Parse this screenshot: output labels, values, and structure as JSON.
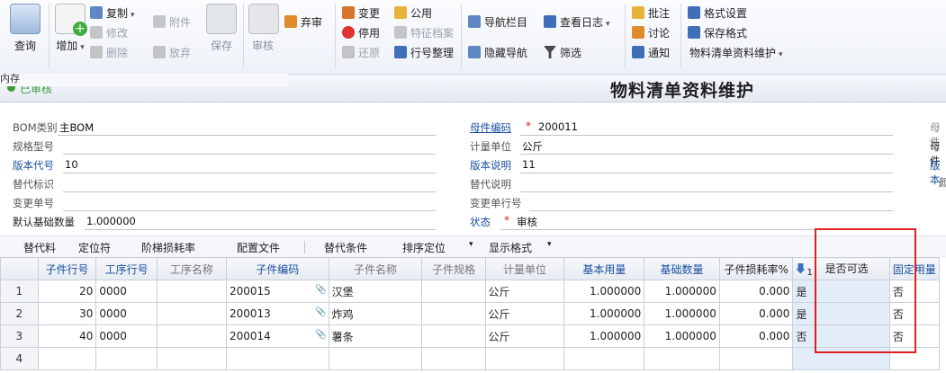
{
  "ribbon": {
    "query": "查询",
    "add": "增加",
    "copy": "复制",
    "modify": "修改",
    "delete": "删除",
    "attach": "附件",
    "abandon": "放弃",
    "save": "保存",
    "audit": "审核",
    "unaudit": "弃审",
    "change": "变更",
    "disable": "停用",
    "restore": "还原",
    "public": "公用",
    "feature_file": "特征档案",
    "row_arrange": "行号整理",
    "nav_bar": "导航栏目",
    "hide_nav": "隐藏导航",
    "view_log": "查看日志",
    "filter": "筛选",
    "annotate": "批注",
    "discuss": "讨论",
    "notify": "通知",
    "format_settings": "格式设置",
    "save_format": "保存格式",
    "format_select": "物料清单资料维护"
  },
  "overlay_text": "内存",
  "status": "已审核",
  "title": "物料清单资料维护",
  "form": {
    "bom_type_label": "BOM类别",
    "bom_type": "主BOM",
    "spec_label": "规格型号",
    "spec": "",
    "version_label": "版本代号",
    "version": "10",
    "alt_label": "替代标识",
    "alt": "",
    "change_no_label": "变更单号",
    "change_no": "",
    "default_qty_label": "默认基础数量",
    "default_qty": "1.000000",
    "parent_code_label": "母件编码",
    "parent_code": "200011",
    "unit_label": "计量单位",
    "unit": "公斤",
    "version_desc_label": "版本说明",
    "version_desc": "11",
    "alt_desc_label": "替代说明",
    "alt_desc": "",
    "change_row_label": "变更单行号",
    "change_row": "",
    "state_label": "状态",
    "state": "审核",
    "right_col": [
      "母件",
      "母件",
      "版本",
      "颜"
    ]
  },
  "grid_toolbar": [
    "替代料",
    "定位符",
    "阶梯损耗率",
    "配置文件",
    "替代条件",
    "排序定位",
    "显示格式"
  ],
  "columns": [
    "子件行号",
    "工序行号",
    "工序名称",
    "子件编码",
    "子件名称",
    "子件规格",
    "计量单位",
    "基本用量",
    "基础数量",
    "子件损耗率%",
    "是否可选",
    "固定用量"
  ],
  "sort_index": "1",
  "rows": [
    {
      "n": "1",
      "line": "20",
      "op": "0000",
      "opname": "",
      "code": "200015",
      "name": "汉堡",
      "spec": "",
      "unit": "公斤",
      "qty": "1.000000",
      "base": "1.000000",
      "loss": "0.000",
      "opt": "是",
      "fixed": "否"
    },
    {
      "n": "2",
      "line": "30",
      "op": "0000",
      "opname": "",
      "code": "200013",
      "name": "炸鸡",
      "spec": "",
      "unit": "公斤",
      "qty": "1.000000",
      "base": "1.000000",
      "loss": "0.000",
      "opt": "是",
      "fixed": "否"
    },
    {
      "n": "3",
      "line": "40",
      "op": "0000",
      "opname": "",
      "code": "200014",
      "name": "薯条",
      "spec": "",
      "unit": "公斤",
      "qty": "1.000000",
      "base": "1.000000",
      "loss": "0.000",
      "opt": "否",
      "fixed": "否"
    },
    {
      "n": "4",
      "line": "",
      "op": "",
      "opname": "",
      "code": "",
      "name": "",
      "spec": "",
      "unit": "",
      "qty": "",
      "base": "",
      "loss": "",
      "opt": "",
      "fixed": ""
    }
  ]
}
